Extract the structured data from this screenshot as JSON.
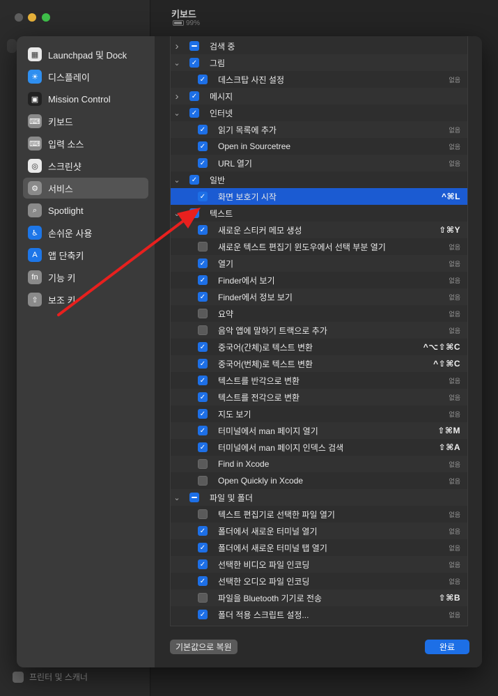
{
  "window": {
    "title": "키보드",
    "battery": "99%",
    "bottom_item": "프린터 및 스캐너"
  },
  "sidebar": {
    "items": [
      {
        "label": "Launchpad 및 Dock",
        "icon": "launchpad-icon",
        "color": "#e9e9e9"
      },
      {
        "label": "디스플레이",
        "icon": "display-icon",
        "color": "#2f8ff0"
      },
      {
        "label": "Mission Control",
        "icon": "mission-control-icon",
        "color": "#222222"
      },
      {
        "label": "키보드",
        "icon": "keyboard-icon",
        "color": "#8a8a8a"
      },
      {
        "label": "입력 소스",
        "icon": "input-source-icon",
        "color": "#8a8a8a"
      },
      {
        "label": "스크린샷",
        "icon": "screenshot-icon",
        "color": "#e9e9e9"
      },
      {
        "label": "서비스",
        "icon": "gear-icon",
        "color": "#8a8a8a"
      },
      {
        "label": "Spotlight",
        "icon": "search-icon",
        "color": "#8a8a8a"
      },
      {
        "label": "손쉬운 사용",
        "icon": "accessibility-icon",
        "color": "#1d76e8"
      },
      {
        "label": "앱 단축키",
        "icon": "app-store-icon",
        "color": "#1d76e8"
      },
      {
        "label": "기능 키",
        "icon": "fn-icon",
        "color": "#8a8a8a"
      },
      {
        "label": "보조 키",
        "icon": "modifier-icon",
        "color": "#8a8a8a"
      }
    ],
    "selected": 6
  },
  "services": [
    {
      "level": 0,
      "expanded": false,
      "check": "dash",
      "label": "검색 중",
      "shortcut": ""
    },
    {
      "level": 0,
      "expanded": true,
      "check": "on",
      "label": "그림",
      "shortcut": ""
    },
    {
      "level": 1,
      "check": "on",
      "label": "데스크탑 사진 설정",
      "shortcut": "없음"
    },
    {
      "level": 0,
      "expanded": false,
      "check": "on",
      "label": "메시지",
      "shortcut": ""
    },
    {
      "level": 0,
      "expanded": true,
      "check": "on",
      "label": "인터넷",
      "shortcut": ""
    },
    {
      "level": 1,
      "check": "on",
      "label": "읽기 목록에 추가",
      "shortcut": "없음"
    },
    {
      "level": 1,
      "check": "on",
      "label": "Open in Sourcetree",
      "shortcut": "없음"
    },
    {
      "level": 1,
      "check": "on",
      "label": "URL 열기",
      "shortcut": "없음"
    },
    {
      "level": 0,
      "expanded": true,
      "check": "on",
      "label": "일반",
      "shortcut": ""
    },
    {
      "level": 1,
      "check": "on",
      "label": "화면 보호기 시작",
      "shortcut": "^⌘L",
      "selected": true
    },
    {
      "level": 0,
      "expanded": true,
      "check": "on",
      "label": "텍스트",
      "shortcut": ""
    },
    {
      "level": 1,
      "check": "on",
      "label": "새로운 스티커 메모 생성",
      "shortcut": "⇧⌘Y"
    },
    {
      "level": 1,
      "check": "off",
      "label": "새로운 텍스트 편집기 윈도우에서 선택 부분 열기",
      "shortcut": "없음"
    },
    {
      "level": 1,
      "check": "on",
      "label": "열기",
      "shortcut": "없음"
    },
    {
      "level": 1,
      "check": "on",
      "label": "Finder에서 보기",
      "shortcut": "없음"
    },
    {
      "level": 1,
      "check": "on",
      "label": "Finder에서 정보 보기",
      "shortcut": "없음"
    },
    {
      "level": 1,
      "check": "off",
      "label": "요약",
      "shortcut": "없음"
    },
    {
      "level": 1,
      "check": "off",
      "label": "음악 앱에 말하기 트랙으로 추가",
      "shortcut": "없음"
    },
    {
      "level": 1,
      "check": "on",
      "label": "중국어(간체)로 텍스트 변환",
      "shortcut": "^⌥⇧⌘C"
    },
    {
      "level": 1,
      "check": "on",
      "label": "중국어(번체)로 텍스트 변환",
      "shortcut": "^⇧⌘C"
    },
    {
      "level": 1,
      "check": "on",
      "label": "텍스트를 반각으로 변환",
      "shortcut": "없음"
    },
    {
      "level": 1,
      "check": "on",
      "label": "텍스트를 전각으로 변환",
      "shortcut": "없음"
    },
    {
      "level": 1,
      "check": "on",
      "label": "지도 보기",
      "shortcut": "없음"
    },
    {
      "level": 1,
      "check": "on",
      "label": "터미널에서 man 페이지 열기",
      "shortcut": "⇧⌘M"
    },
    {
      "level": 1,
      "check": "on",
      "label": "터미널에서 man 페이지 인덱스 검색",
      "shortcut": "⇧⌘A"
    },
    {
      "level": 1,
      "check": "off",
      "label": "Find in Xcode",
      "shortcut": "없음"
    },
    {
      "level": 1,
      "check": "off",
      "label": "Open Quickly in Xcode",
      "shortcut": "없음"
    },
    {
      "level": 0,
      "expanded": true,
      "check": "dash",
      "label": "파일 및 폴더",
      "shortcut": ""
    },
    {
      "level": 1,
      "check": "off",
      "label": "텍스트 편집기로 선택한 파일 열기",
      "shortcut": "없음"
    },
    {
      "level": 1,
      "check": "on",
      "label": "폴더에서 새로운 터미널 열기",
      "shortcut": "없음"
    },
    {
      "level": 1,
      "check": "on",
      "label": "폴더에서 새로운 터미널 탭 열기",
      "shortcut": "없음"
    },
    {
      "level": 1,
      "check": "on",
      "label": "선택한 비디오 파일 인코딩",
      "shortcut": "없음"
    },
    {
      "level": 1,
      "check": "on",
      "label": "선택한 오디오 파일 인코딩",
      "shortcut": "없음"
    },
    {
      "level": 1,
      "check": "off",
      "label": "파일을 Bluetooth 기기로 전송",
      "shortcut": "⇧⌘B"
    },
    {
      "level": 1,
      "check": "on",
      "label": "폴더 적용 스크립트 설정...",
      "shortcut": "없음"
    }
  ],
  "buttons": {
    "restore": "기본값으로 복원",
    "done": "완료"
  },
  "colors": {
    "accent": "#1d6fe6",
    "selection": "#1b5bd2",
    "annotation_arrow": "#e8201e"
  }
}
